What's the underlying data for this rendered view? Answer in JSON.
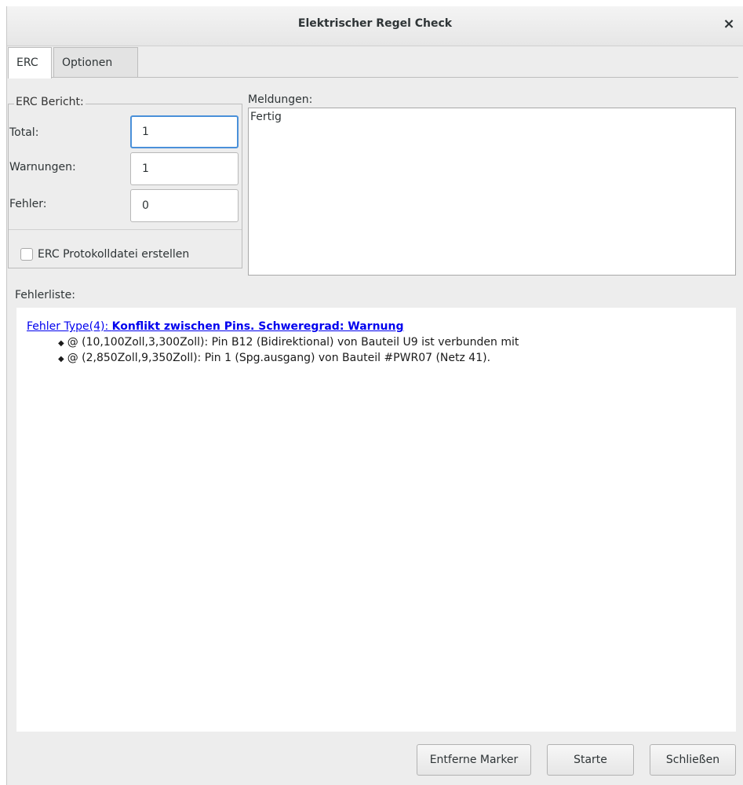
{
  "window": {
    "title": "Elektrischer Regel Check",
    "close_glyph": "×"
  },
  "tabs": [
    {
      "label": "ERC",
      "active": true
    },
    {
      "label": "Optionen",
      "active": false
    }
  ],
  "report": {
    "legend": "ERC Bericht:",
    "total_label": "Total:",
    "total_value": "1",
    "warnings_label": "Warnungen:",
    "warnings_value": "1",
    "errors_label": "Fehler:",
    "errors_value": "0",
    "logfile_label": "ERC Protokolldatei erstellen",
    "logfile_checked": false
  },
  "messages": {
    "label": "Meldungen:",
    "text": "Fertig"
  },
  "error_list": {
    "label": "Fehlerliste:",
    "entry": {
      "type_text": "Fehler Type(4): ",
      "summary": "Konflikt zwischen Pins. Schweregrad: Warnung",
      "items": [
        "@ (10,100Zoll,3,300Zoll): Pin B12 (Bidirektional) von Bauteil U9 ist verbunden mit",
        "@ (2,850Zoll,9,350Zoll): Pin 1 (Spg.ausgang) von Bauteil #PWR07 (Netz 41)."
      ]
    }
  },
  "buttons": {
    "remove_markers": "Entferne Marker",
    "start": "Starte",
    "close": "Schließen"
  },
  "colors": {
    "link": "#0000ee",
    "focus": "#4a90d9",
    "background": "#ededed"
  }
}
